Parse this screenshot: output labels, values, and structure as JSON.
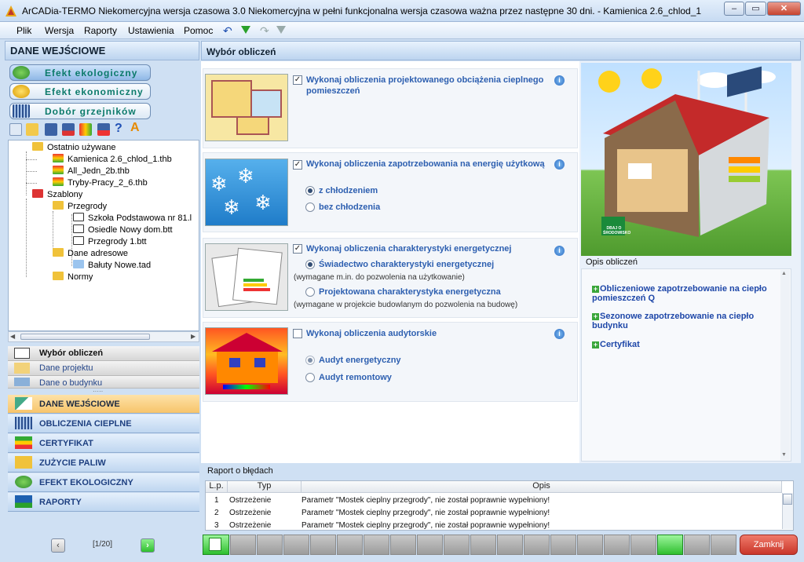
{
  "window": {
    "title": "ArCADia-TERMO Niekomercyjna wersja czasowa 3.0 Niekomercyjna w pełni funkcjonalna wersja czasowa ważna przez następne 30 dni. - Kamienica 2.6_chlod_1"
  },
  "menu": [
    "Plik",
    "Wersja",
    "Raporty",
    "Ustawienia",
    "Pomoc"
  ],
  "left": {
    "header": "DANE WEJŚCIOWE",
    "mode_buttons": [
      "Efekt ekologiczny",
      "Efekt ekonomiczny",
      "Dobór grzejników"
    ],
    "tree": {
      "recent_label": "Ostatnio używane",
      "recent": [
        "Kamienica 2.6_chlod_1.thb",
        "All_Jedn_2b.thb",
        "Tryby-Pracy_2_6.thb"
      ],
      "templates_label": "Szablony",
      "partitions_label": "Przegrody",
      "partitions": [
        "Szkoła Podstawowa nr 81.l",
        "Osiedle Nowy dom.btt",
        "Przegrody 1.btt"
      ],
      "address_label": "Dane adresowe",
      "address": [
        "Bałuty Nowe.tad"
      ],
      "norms_label": "Normy"
    },
    "sub_nav": [
      "Wybór obliczeń",
      "Dane projektu",
      "Dane o budynku"
    ],
    "main_nav": [
      "DANE WEJŚCIOWE",
      "OBLICZENIA CIEPLNE",
      "CERTYFIKAT",
      "ZUŻYCIE PALIW",
      "EFEKT EKOLOGICZNY",
      "RAPORTY"
    ],
    "pager": "[1/20]"
  },
  "center": {
    "header": "Wybór obliczeń",
    "opt1": "Wykonaj obliczenia projektowanego obciążenia cieplnego pomieszczeń",
    "opt2": "Wykonaj obliczenia zapotrzebowania na energię użytkową",
    "opt2_a": "z chłodzeniem",
    "opt2_b": "bez chłodzenia",
    "opt3": "Wykonaj obliczenia charakterystyki energetycznej",
    "opt3_a": "Świadectwo charakterystyki energetycznej",
    "opt3_a_note": "(wymagane m.in. do pozwolenia na użytkowanie)",
    "opt3_b": "Projektowana charakterystyka energetyczna",
    "opt3_b_note": "(wymagane w projekcie budowlanym do pozwolenia na budowę)",
    "opt4": "Wykonaj obliczenia audytorskie",
    "opt4_a": "Audyt energetyczny",
    "opt4_b": "Audyt remontowy",
    "house_sign": "DBAJ O ŚRODOWISKO"
  },
  "right": {
    "label": "Opis obliczeń",
    "links": [
      "Obliczeniowe zapotrzebowanie na ciepło pomieszczeń Q",
      "Sezonowe zapotrzebowanie na ciepło budynku",
      "Certyfikat"
    ]
  },
  "report": {
    "label": "Raport o błędach",
    "columns": [
      "L.p.",
      "Typ",
      "Opis"
    ],
    "rows": [
      [
        "1",
        "Ostrzeżenie",
        "Parametr \"Mostek cieplny przegrody\", nie został poprawnie wypełniony!"
      ],
      [
        "2",
        "Ostrzeżenie",
        "Parametr \"Mostek cieplny przegrody\", nie został poprawnie wypełniony!"
      ],
      [
        "3",
        "Ostrzeżenie",
        "Parametr \"Mostek cieplny przegrody\", nie został poprawnie wypełniony!"
      ]
    ]
  },
  "bottom": {
    "close": "Zamknij"
  },
  "colors": {
    "accent_green": "#2fbf2f",
    "selected_nav": "#f7c46a",
    "link": "#1e47a8",
    "close_red": "#c9362a"
  }
}
